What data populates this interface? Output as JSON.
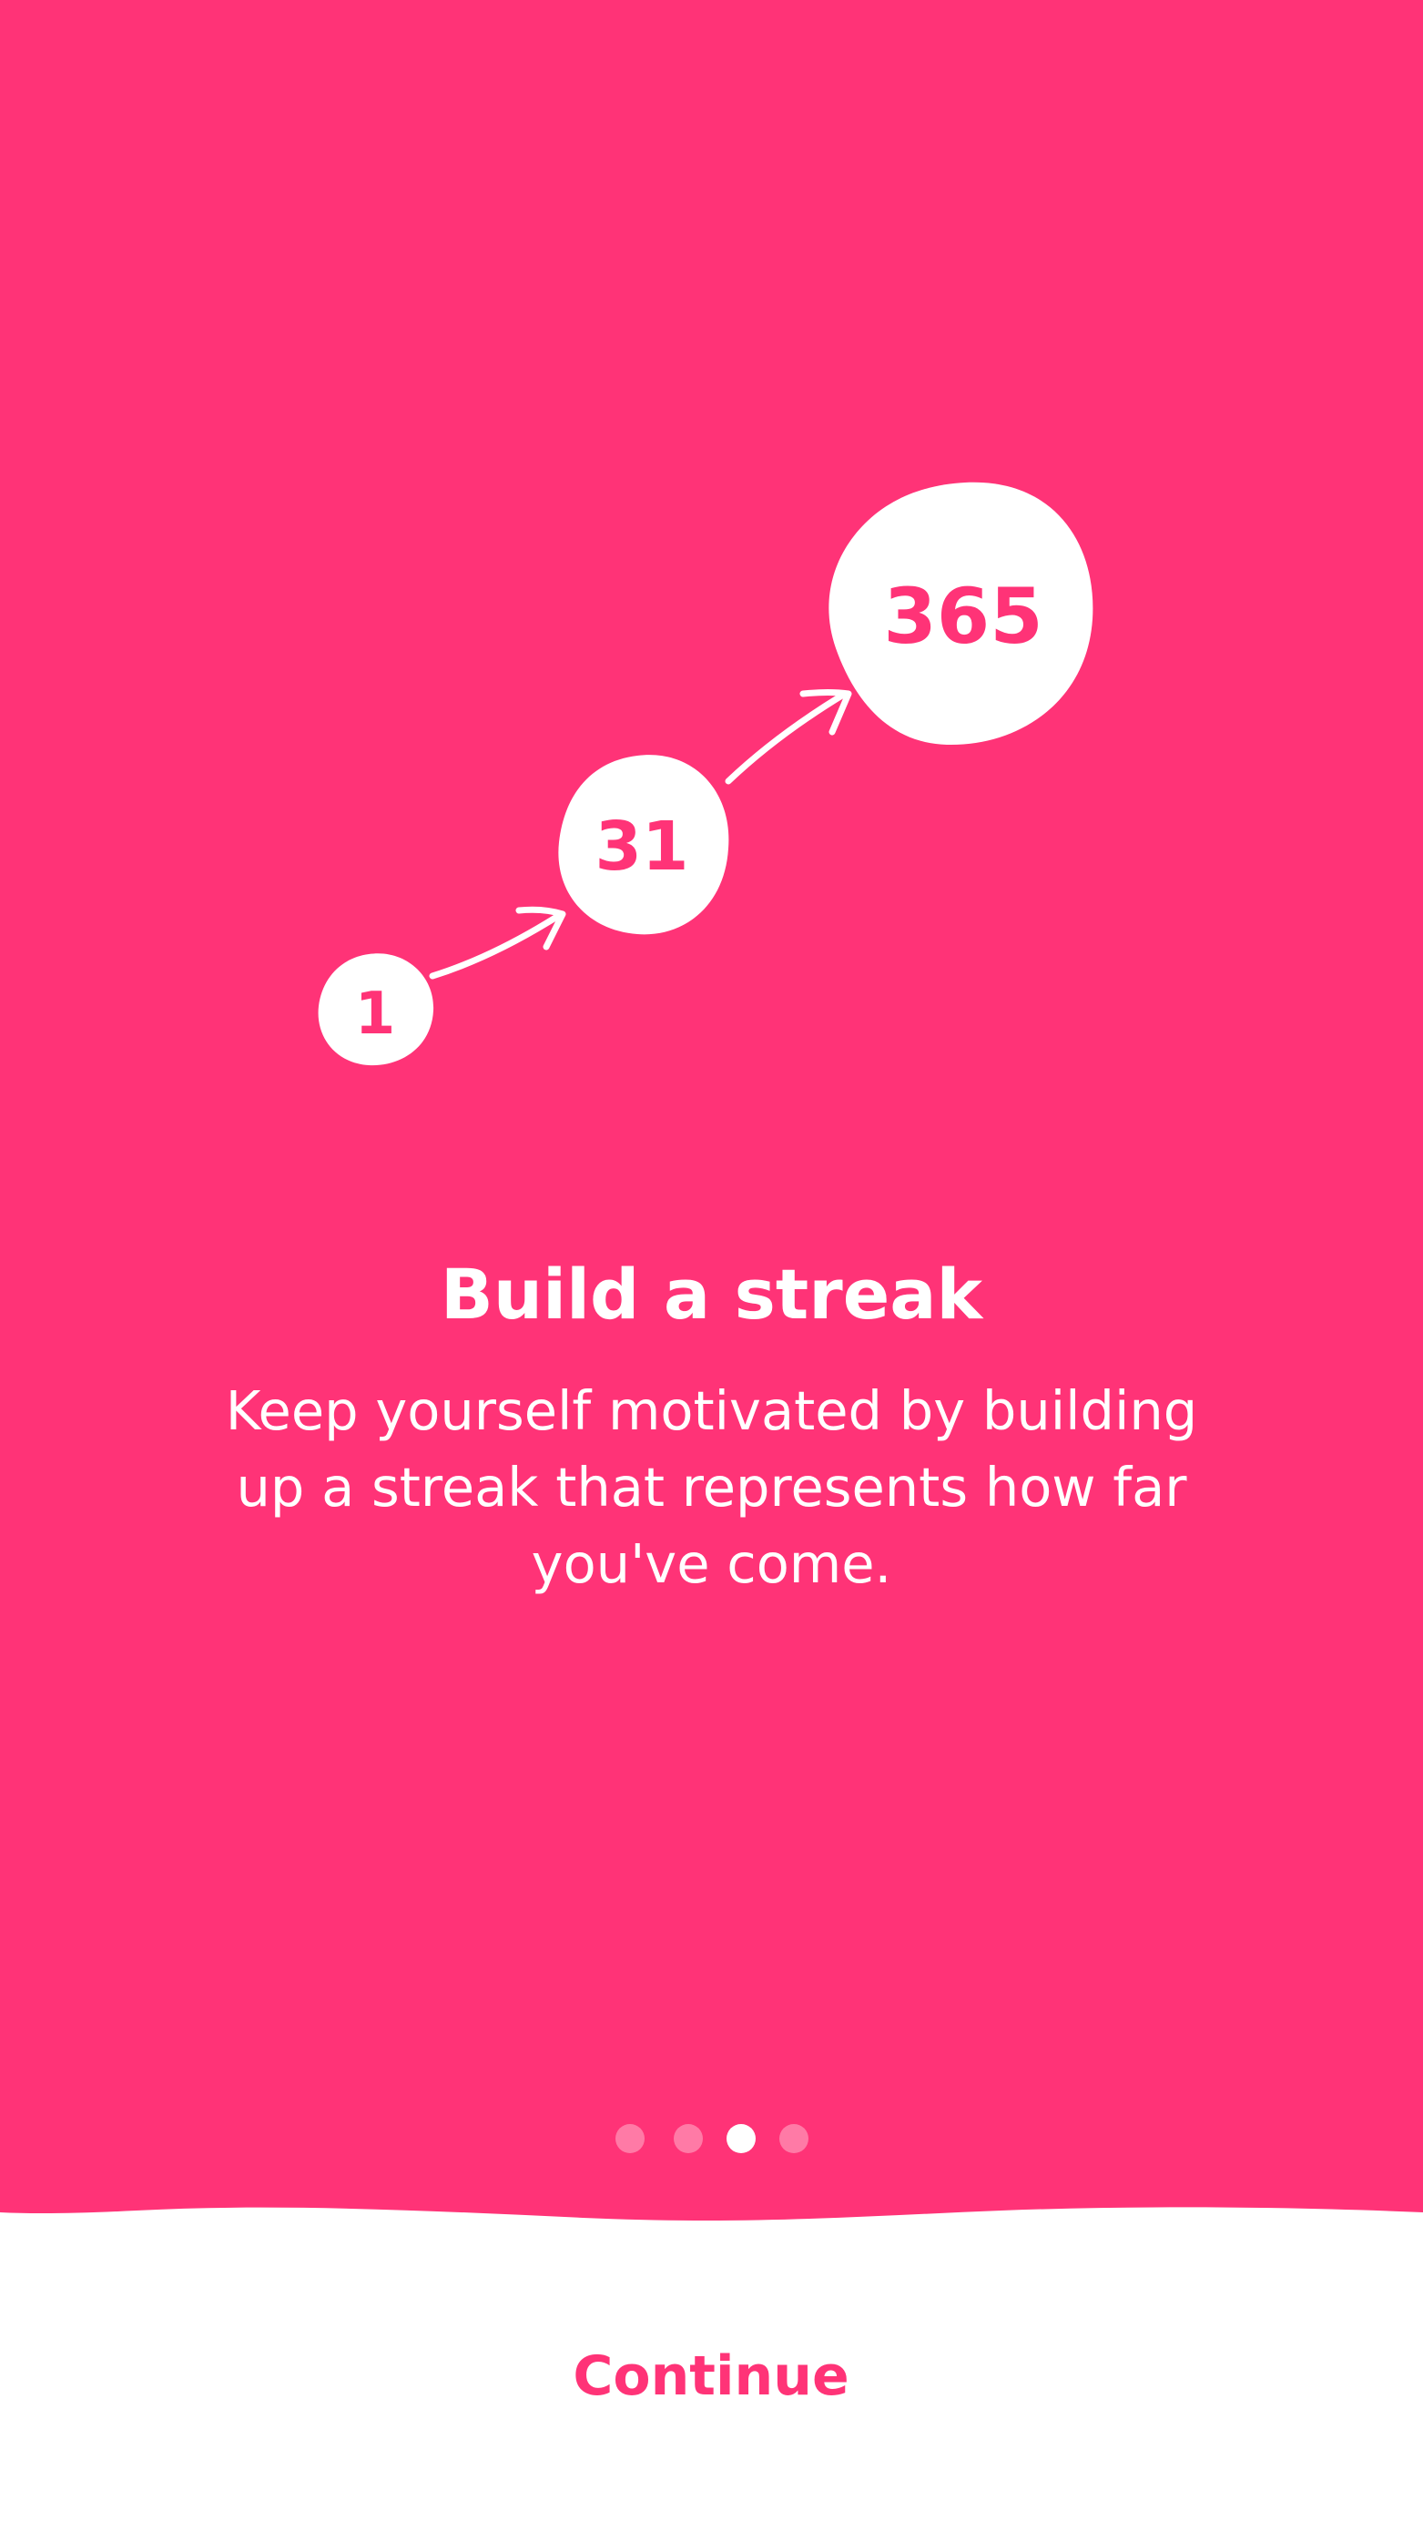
{
  "colors": {
    "brand": "#FF3377",
    "background": "#FFFFFF",
    "on_brand": "#FFFFFF",
    "dot_inactive": "rgba(255,255,255,0.35)"
  },
  "illustration": {
    "streak_values": [
      "1",
      "31",
      "365"
    ],
    "arrow_icon": "hand-drawn-arrow-icon"
  },
  "onboarding": {
    "title": "Build a streak",
    "description": "Keep yourself motivated by building up a streak that represents how far you've come."
  },
  "pager": {
    "total_pages": 4,
    "current_page": 3
  },
  "footer": {
    "continue_label": "Continue"
  }
}
